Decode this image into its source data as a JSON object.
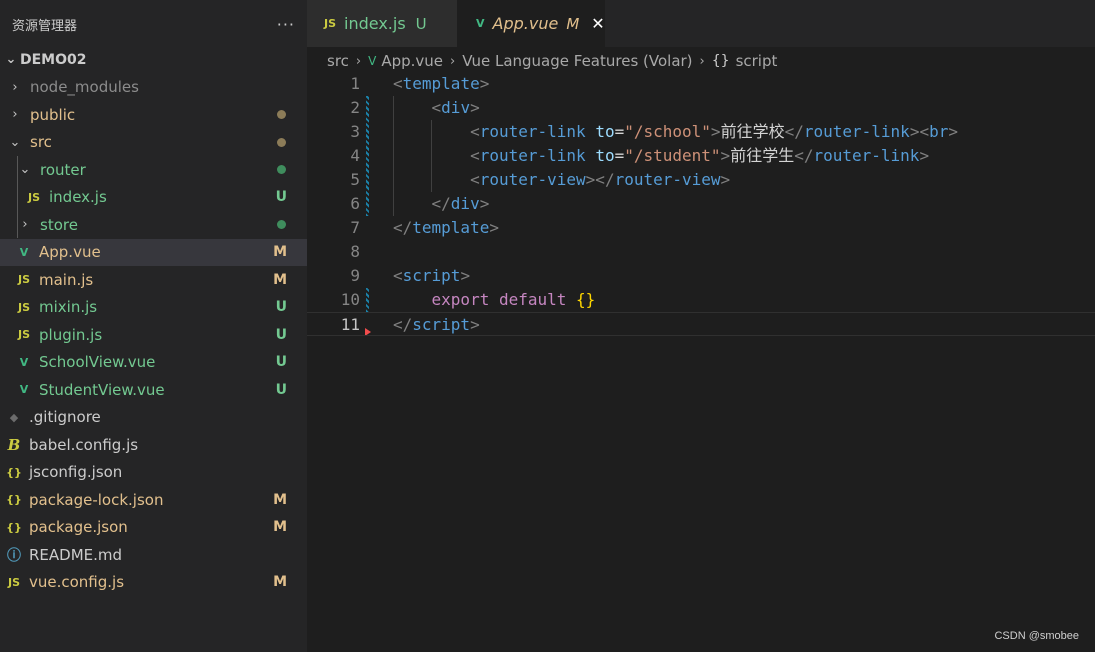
{
  "explorer": {
    "title": "资源管理器",
    "more_label": "···",
    "project": "DEMO02",
    "items": [
      {
        "label": "node_modules",
        "badge": "",
        "dot": ""
      },
      {
        "label": "public",
        "badge": "",
        "dot": "#8c7c58"
      },
      {
        "label": "src",
        "badge": "",
        "dot": "#8c7c58"
      },
      {
        "label": "router",
        "badge": "",
        "dot": "#3f8d5d"
      },
      {
        "label": "index.js",
        "badge": "U",
        "dot": ""
      },
      {
        "label": "store",
        "badge": "",
        "dot": "#3f8d5d"
      },
      {
        "label": "App.vue",
        "badge": "M",
        "dot": ""
      },
      {
        "label": "main.js",
        "badge": "M",
        "dot": ""
      },
      {
        "label": "mixin.js",
        "badge": "U",
        "dot": ""
      },
      {
        "label": "plugin.js",
        "badge": "U",
        "dot": ""
      },
      {
        "label": "SchoolView.vue",
        "badge": "U",
        "dot": ""
      },
      {
        "label": "StudentView.vue",
        "badge": "U",
        "dot": ""
      },
      {
        "label": ".gitignore",
        "badge": "",
        "dot": ""
      },
      {
        "label": "babel.config.js",
        "badge": "",
        "dot": ""
      },
      {
        "label": "jsconfig.json",
        "badge": "",
        "dot": ""
      },
      {
        "label": "package-lock.json",
        "badge": "M",
        "dot": ""
      },
      {
        "label": "package.json",
        "badge": "M",
        "dot": ""
      },
      {
        "label": "README.md",
        "badge": "",
        "dot": ""
      },
      {
        "label": "vue.config.js",
        "badge": "M",
        "dot": ""
      }
    ]
  },
  "icons": {
    "js": "JS",
    "json": "{}",
    "babel": "B",
    "info": "ⓘ",
    "git": "◆",
    "vue": "V",
    "chevron_right": "›",
    "chevron_down": "⌄",
    "close": "✕"
  },
  "tabs": [
    {
      "label": "index.js",
      "status": "U",
      "icon": "js-icon"
    },
    {
      "label": "App.vue",
      "status": "M",
      "icon": "vue-icon",
      "active": true
    }
  ],
  "breadcrumb": {
    "items": [
      "src",
      "App.vue",
      "Vue Language Features (Volar)",
      "script"
    ]
  },
  "editor": {
    "line_numbers": [
      "1",
      "2",
      "3",
      "4",
      "5",
      "6",
      "7",
      "8",
      "9",
      "10",
      "11"
    ],
    "current_line": "11",
    "tokens": {
      "template": "template",
      "div": "div",
      "router_link": "router-link",
      "to": "to",
      "school_path": "\"/school\"",
      "student_path": "\"/student\"",
      "text_school": "前往学校",
      "text_student": "前往学生",
      "br": "br",
      "router_view": "router-view",
      "script": "script",
      "export": "export",
      "default": "default",
      "braces": "{}"
    }
  },
  "watermark": "CSDN @smobee",
  "colors": {
    "modified": "#e2c08d",
    "untracked": "#73c991",
    "tag": "#569cd6",
    "attribute": "#9cdcfe",
    "string": "#ce9178",
    "keyword": "#c586c0"
  }
}
